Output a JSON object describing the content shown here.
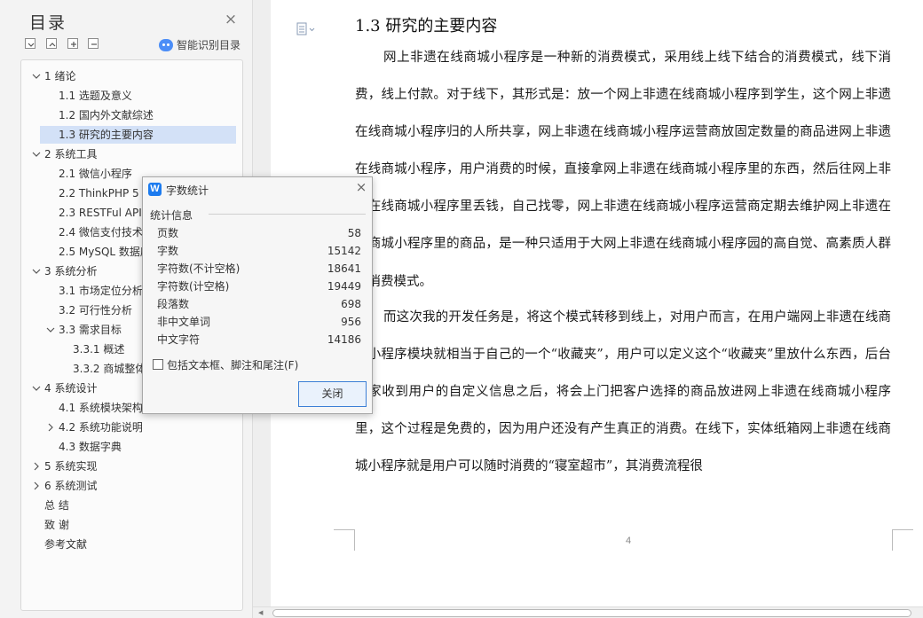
{
  "toc": {
    "title": "目录",
    "smart_toc_label": "智能识别目录",
    "items": [
      {
        "label": "1  绪论",
        "arrow": "v"
      },
      {
        "label": "1.1  选题及意义",
        "arrow": ""
      },
      {
        "label": "1.2  国内外文献综述",
        "arrow": ""
      },
      {
        "label": "1.3  研究的主要内容",
        "arrow": "",
        "selected": true
      },
      {
        "label": "2  系统工具",
        "arrow": "v"
      },
      {
        "label": "2.1  微信小程序",
        "arrow": ""
      },
      {
        "label": "2.2 ThinkPHP 5",
        "arrow": ""
      },
      {
        "label": "2.3 RESTFul API",
        "arrow": ""
      },
      {
        "label": "2.4  微信支付技术",
        "arrow": ""
      },
      {
        "label": "2.5 MySQL 数据库",
        "arrow": ""
      },
      {
        "label": "3  系统分析",
        "arrow": "v"
      },
      {
        "label": "3.1  市场定位分析",
        "arrow": ""
      },
      {
        "label": "3.2  可行性分析",
        "arrow": ""
      },
      {
        "label": "3.3  需求目标",
        "arrow": "v"
      },
      {
        "label": "3.3.1  概述",
        "arrow": ""
      },
      {
        "label": "3.3.2  商城整体",
        "arrow": ""
      },
      {
        "label": "4  系统设计",
        "arrow": "v"
      },
      {
        "label": "4.1 系统模块架构",
        "arrow": ""
      },
      {
        "label": "4.2 系统功能说明",
        "arrow": ">"
      },
      {
        "label": "4.3  数据字典",
        "arrow": ""
      },
      {
        "label": "5  系统实现",
        "arrow": ">"
      },
      {
        "label": "6  系统测试",
        "arrow": ">"
      },
      {
        "label": "总    结",
        "arrow": ""
      },
      {
        "label": "致    谢",
        "arrow": ""
      },
      {
        "label": "参考文献",
        "arrow": ""
      }
    ]
  },
  "document": {
    "heading": "1.3  研究的主要内容",
    "paragraphs": [
      "网上非遗在线商城小程序是一种新的消费模式，采用线上线下结合的消费模式，线下消费，线上付款。对于线下，其形式是：放一个网上非遗在线商城小程序到学生，这个网上非遗在线商城小程序归的人所共享，网上非遗在线商城小程序运营商放固定数量的商品进网上非遗在线商城小程序，用户消费的时候，直接拿网上非遗在线商城小程序里的东西，然后往网上非遗在线商城小程序里丢钱，自己找零，网上非遗在线商城小程序运营商定期去维护网上非遗在线商城小程序里的商品，是一种只适用于大网上非遗在线商城小程序园的高自觉、高素质人群的消费模式。",
      "而这次我的开发任务是，将这个模式转移到线上，对用户而言，在用户端网上非遗在线商城小程序模块就相当于自己的一个“收藏夹”，用户可以定义这个“收藏夹”里放什么东西，后台商家收到用户的自定义信息之后，将会上门把客户选择的商品放进网上非遗在线商城小程序里，这个过程是免费的，因为用户还没有产生真正的消费。在线下，实体纸箱网上非遗在线商城小程序就是用户可以随时消费的“寝室超市”，其消费流程很"
    ],
    "page_number": "4"
  },
  "dialog": {
    "title": "字数统计",
    "group_label": "统计信息",
    "stats": [
      {
        "label": "页数",
        "value": "58"
      },
      {
        "label": "字数",
        "value": "15142"
      },
      {
        "label": "字符数(不计空格)",
        "value": "18641"
      },
      {
        "label": "字符数(计空格)",
        "value": "19449"
      },
      {
        "label": "段落数",
        "value": "698"
      },
      {
        "label": "非中文单词",
        "value": "956"
      },
      {
        "label": "中文字符",
        "value": "14186"
      }
    ],
    "include_label": "包括文本框、脚注和尾注(F)",
    "include_checked": false,
    "close_button": "关闭"
  }
}
